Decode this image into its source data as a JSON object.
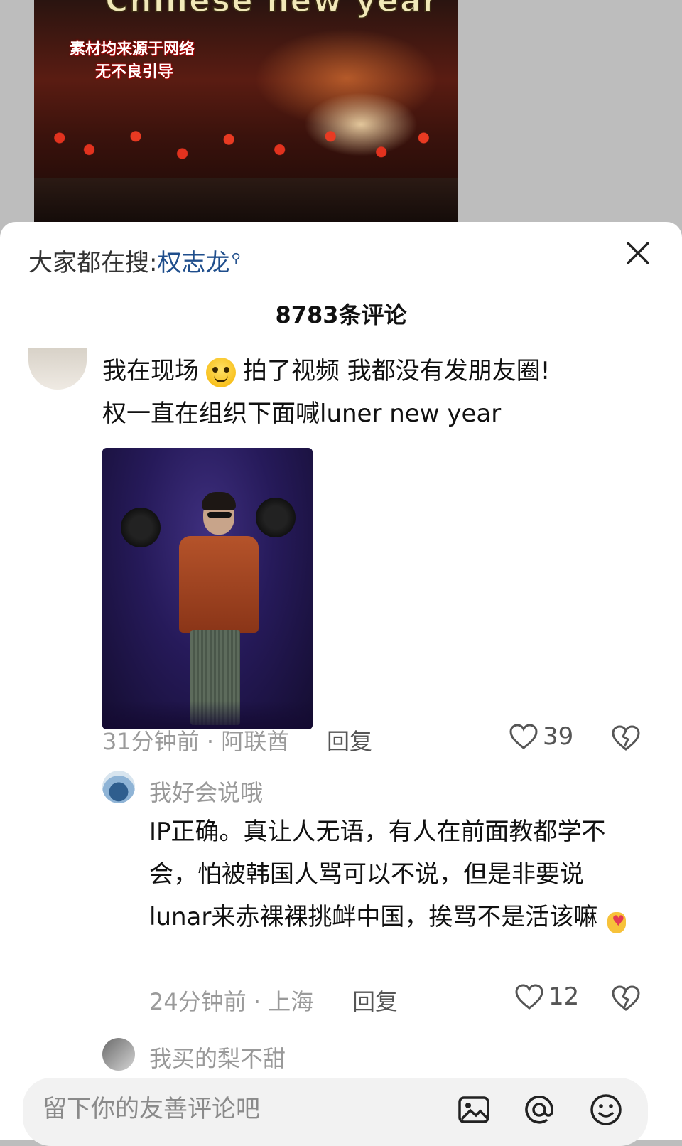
{
  "video": {
    "title": "Chinese new year",
    "watermark_line1": "素材均来源于网络",
    "watermark_line2": "无不良引导"
  },
  "sheet": {
    "search_prefix": "大家都在搜:",
    "search_keyword": "权志龙",
    "comment_count": "8783条评论",
    "close_icon": "close-icon"
  },
  "comments": [
    {
      "text_line1a": "我在现场",
      "emoji": "smile-emoji",
      "text_line1b": "拍了视频 我都没有发朋友圈!",
      "text_line2": "权一直在组织下面喊luner new year",
      "meta": "31分钟前 · 阿联酋",
      "reply_label": "回复",
      "likes": "39"
    }
  ],
  "reply": {
    "username": "我好会说哦",
    "text": "IP正确。真让人无语，有人在前面教都学不会，怕被韩国人骂可以不说，但是非要说lunar来赤裸裸挑衅中国，挨骂不是活该嘛",
    "emoji": "finger-heart-emoji",
    "meta": "24分钟前 · 上海",
    "reply_label": "回复",
    "likes": "12"
  },
  "next_comment": {
    "username": "我买的梨不甜"
  },
  "input": {
    "placeholder": "留下你的友善评论吧",
    "icons": [
      "image-icon",
      "at-icon",
      "emoji-icon"
    ]
  },
  "colors": {
    "keyword": "#1f4e8c",
    "meta_text": "#9a9a9a",
    "sheet_bg": "#ffffff",
    "backdrop": "#bdbdbd"
  }
}
